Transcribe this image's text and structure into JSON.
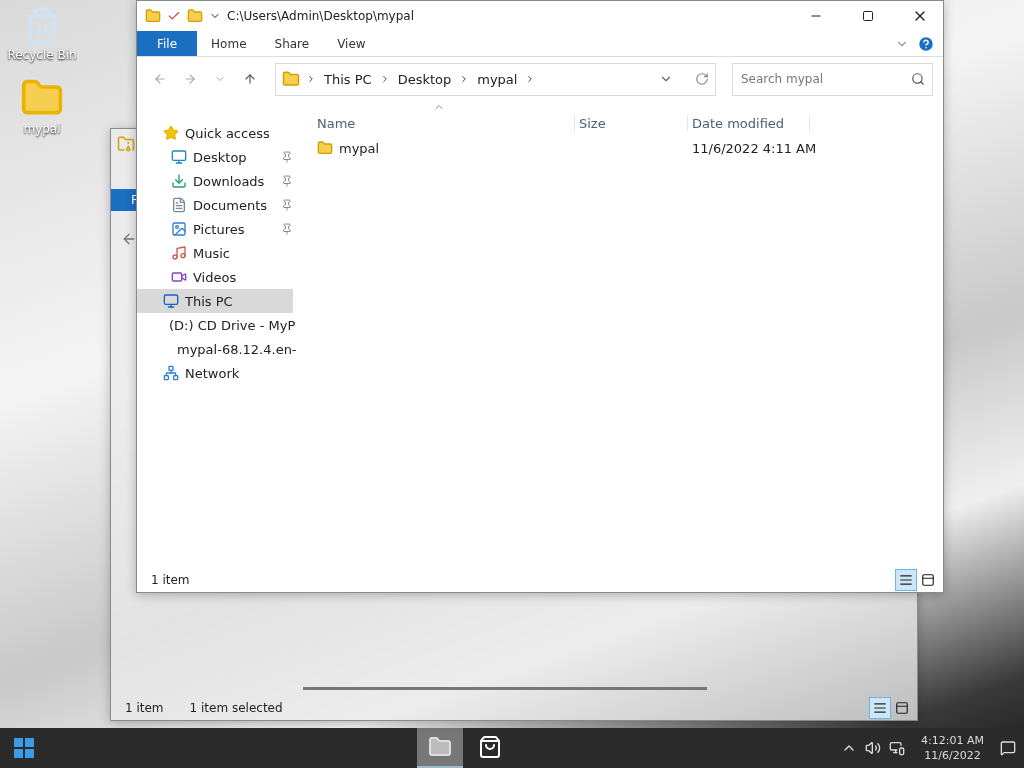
{
  "desktop": {
    "icons": [
      {
        "label": "Recycle Bin",
        "kind": "recycle"
      },
      {
        "label": "mypal",
        "kind": "folder"
      }
    ]
  },
  "back_window": {
    "ribbon_tab": "F",
    "status": [
      "1 item",
      "1 item selected"
    ],
    "views": [
      {
        "kind": "details",
        "selected": true
      },
      {
        "kind": "preview",
        "selected": false
      }
    ]
  },
  "window": {
    "title": "C:\\Users\\Admin\\Desktop\\mypal",
    "ribbon_tabs": [
      {
        "label": "File",
        "kind": "menu"
      },
      {
        "label": "Home",
        "kind": "tab"
      },
      {
        "label": "Share",
        "kind": "tab"
      },
      {
        "label": "View",
        "kind": "tab"
      }
    ],
    "breadcrumbs": [
      "This PC",
      "Desktop",
      "mypal"
    ],
    "search": {
      "placeholder": "Search mypal"
    },
    "nav": [
      {
        "label": "Quick access",
        "kind": "star",
        "selected": false,
        "children": [
          {
            "label": "Desktop",
            "kind": "desktop",
            "pinned": true,
            "selected": false
          },
          {
            "label": "Downloads",
            "kind": "download",
            "pinned": true,
            "selected": false
          },
          {
            "label": "Documents",
            "kind": "document",
            "pinned": true,
            "selected": false
          },
          {
            "label": "Pictures",
            "kind": "picture",
            "pinned": true,
            "selected": false
          },
          {
            "label": "Music",
            "kind": "music",
            "pinned": false,
            "selected": false
          },
          {
            "label": "Videos",
            "kind": "video",
            "pinned": false,
            "selected": false
          }
        ]
      },
      {
        "label": "This PC",
        "kind": "pc",
        "selected": true
      },
      {
        "label": "(D:) CD Drive - MyP",
        "kind": "drive",
        "selected": false,
        "children": [
          {
            "label": "mypal-68.12.4.en-",
            "kind": "zip",
            "pinned": false,
            "selected": false
          }
        ]
      },
      {
        "label": "Network",
        "kind": "network",
        "selected": false
      }
    ],
    "columns": [
      "Name",
      "Size",
      "Date modified"
    ],
    "rows": [
      {
        "name": "mypal",
        "kind": "folder",
        "date_modified": "11/6/2022 4:11 AM"
      }
    ],
    "status": "1 item",
    "views": [
      {
        "kind": "details",
        "selected": true
      },
      {
        "kind": "preview",
        "selected": false
      }
    ]
  },
  "taskbar": {
    "apps": [
      {
        "kind": "explorer",
        "selected": true
      },
      {
        "kind": "store",
        "selected": false
      }
    ],
    "time": "4:12:01 AM",
    "date": "11/6/2022"
  }
}
